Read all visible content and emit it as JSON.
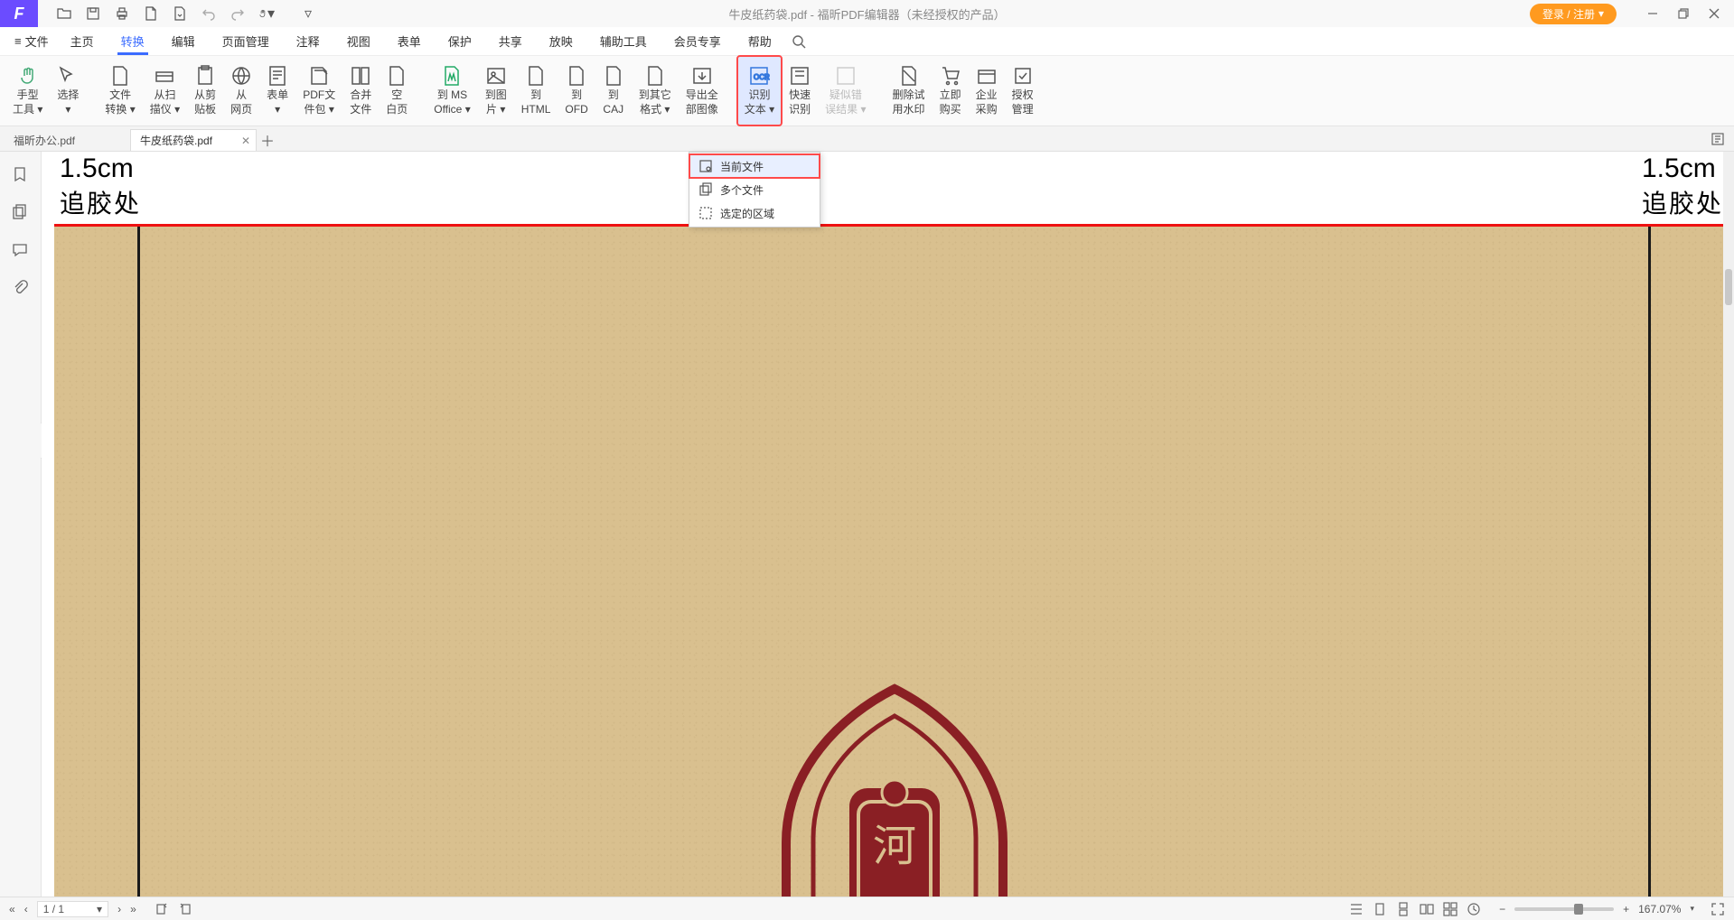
{
  "app": {
    "title": "牛皮纸药袋.pdf - 福昕PDF编辑器（未经授权的产品）",
    "login_btn": "登录 / 注册"
  },
  "menubar": {
    "file": "文件",
    "items": [
      "主页",
      "转换",
      "编辑",
      "页面管理",
      "注释",
      "视图",
      "表单",
      "保护",
      "共享",
      "放映",
      "辅助工具",
      "会员专享",
      "帮助"
    ],
    "active_index": 1
  },
  "ribbon": {
    "hand": {
      "l1": "手型",
      "l2": "工具"
    },
    "select": {
      "l1": "选择",
      "l2": ""
    },
    "fileconv": {
      "l1": "文件",
      "l2": "转换"
    },
    "scanner": {
      "l1": "从扫",
      "l2": "描仪"
    },
    "clipboard": {
      "l1": "从剪",
      "l2": "贴板"
    },
    "webpage": {
      "l1": "从",
      "l2": "网页"
    },
    "form": {
      "l1": "表单",
      "l2": ""
    },
    "pdfpkg": {
      "l1": "PDF文",
      "l2": "件包"
    },
    "merge": {
      "l1": "合并",
      "l2": "文件"
    },
    "blank": {
      "l1": "空",
      "l2": "白页"
    },
    "tomso": {
      "l1": "到 MS",
      "l2": "Office"
    },
    "toimg": {
      "l1": "到图",
      "l2": "片"
    },
    "tohtml": {
      "l1": "到",
      "l2": "HTML"
    },
    "toofd": {
      "l1": "到",
      "l2": "OFD"
    },
    "tocaj": {
      "l1": "到",
      "l2": "CAJ"
    },
    "toother": {
      "l1": "到其它",
      "l2": "格式"
    },
    "exportimg": {
      "l1": "导出全",
      "l2": "部图像"
    },
    "ocr": {
      "l1": "识别",
      "l2": "文本"
    },
    "fastocr": {
      "l1": "快速",
      "l2": "识别"
    },
    "suspect": {
      "l1": "疑似错",
      "l2": "误结果"
    },
    "delwm": {
      "l1": "删除试",
      "l2": "用水印"
    },
    "buy": {
      "l1": "立即",
      "l2": "购买"
    },
    "ent": {
      "l1": "企业",
      "l2": "采购"
    },
    "auth": {
      "l1": "授权",
      "l2": "管理"
    }
  },
  "tabs": {
    "items": [
      {
        "name": "福昕办公.pdf",
        "active": false
      },
      {
        "name": "牛皮纸药袋.pdf",
        "active": true
      }
    ]
  },
  "dropdown": {
    "items": [
      "当前文件",
      "多个文件",
      "选定的区域"
    ],
    "highlight_index": 0
  },
  "document": {
    "measure_cm": "1.5cm",
    "measure_zh": "追胶处"
  },
  "statusbar": {
    "page": "1 / 1",
    "zoom": "167.07%"
  }
}
